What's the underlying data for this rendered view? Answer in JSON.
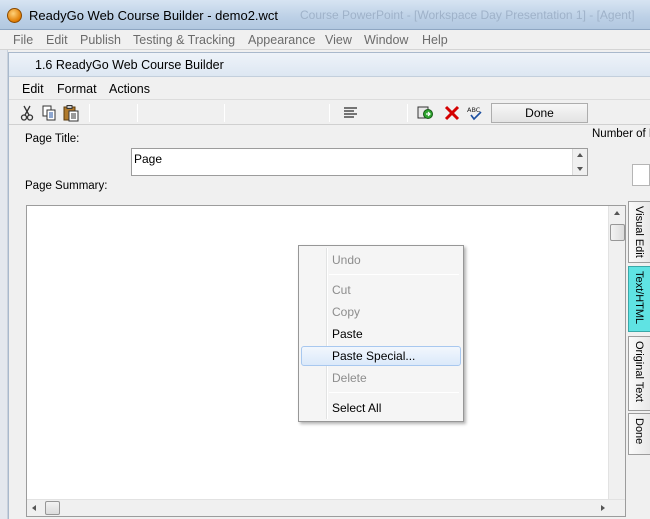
{
  "outer_window": {
    "title": "ReadyGo Web Course Builder - demo2.wct",
    "faded_title": "Course PowerPoint - [Workspace Day Presentation 1] - [Agent]"
  },
  "outer_menu": [
    "File",
    "Edit",
    "Publish",
    "Testing & Tracking",
    "Appearance",
    "View",
    "Window",
    "Help"
  ],
  "inner_window": {
    "title": "1.6  ReadyGo Web Course Builder"
  },
  "inner_menu": [
    "Edit",
    "Format",
    "Actions"
  ],
  "toolbar": {
    "done_label": "Done",
    "icons": [
      "cut-icon",
      "copy-icon",
      "paste-icon",
      "align-icon",
      "insert-icon",
      "delete-icon",
      "spellcheck-icon"
    ],
    "spellcheck_text": "ABC"
  },
  "form": {
    "page_title_label": "Page Title:",
    "page_title_value": "Page",
    "page_summary_label": "Page Summary:",
    "number_label": "Number of B"
  },
  "context_menu": {
    "items": [
      {
        "label": "Undo",
        "enabled": false
      },
      {
        "label": "Cut",
        "enabled": false
      },
      {
        "label": "Copy",
        "enabled": false
      },
      {
        "label": "Paste",
        "enabled": true
      },
      {
        "label": "Paste Special...",
        "enabled": true,
        "highlighted": true
      },
      {
        "label": "Delete",
        "enabled": false
      },
      {
        "label": "Select All",
        "enabled": true
      }
    ]
  },
  "side_tabs": [
    {
      "label": "Visual Edit",
      "active": false
    },
    {
      "label": "Text/HTML",
      "active": true
    },
    {
      "label": "Original Text",
      "active": false
    },
    {
      "label": "Done",
      "active": false
    }
  ],
  "colors": {
    "active_tab": "#5fe3e3",
    "delete_red": "#d40000",
    "menu_highlight": "#dbe9fa"
  }
}
